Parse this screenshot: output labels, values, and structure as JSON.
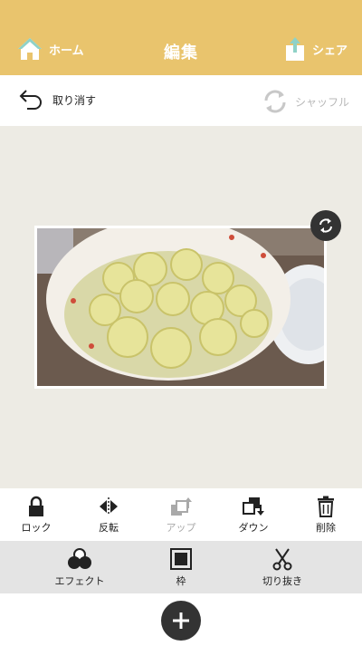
{
  "header": {
    "home_label": "ホーム",
    "title": "編集",
    "share_label": "シェア"
  },
  "undo_bar": {
    "undo_label": "取り消す",
    "shuffle_label": "シャッフル"
  },
  "toolbar_primary": [
    {
      "label": "ロック",
      "icon": "lock-icon",
      "enabled": true
    },
    {
      "label": "反転",
      "icon": "flip-icon",
      "enabled": true
    },
    {
      "label": "アップ",
      "icon": "layer-up-icon",
      "enabled": false
    },
    {
      "label": "ダウン",
      "icon": "layer-down-icon",
      "enabled": true
    },
    {
      "label": "削除",
      "icon": "trash-icon",
      "enabled": true
    }
  ],
  "toolbar_secondary": [
    {
      "label": "エフェクト",
      "icon": "effect-icon"
    },
    {
      "label": "枠",
      "icon": "frame-icon"
    },
    {
      "label": "切り抜き",
      "icon": "scissors-icon"
    }
  ],
  "colors": {
    "header": "#e9c46d",
    "canvas": "#edebe4",
    "secondary_toolbar": "#e4e4e4",
    "dark_button": "#333333",
    "home_icon": "#8fd2c7",
    "share_arrow": "#8fd2c7"
  }
}
